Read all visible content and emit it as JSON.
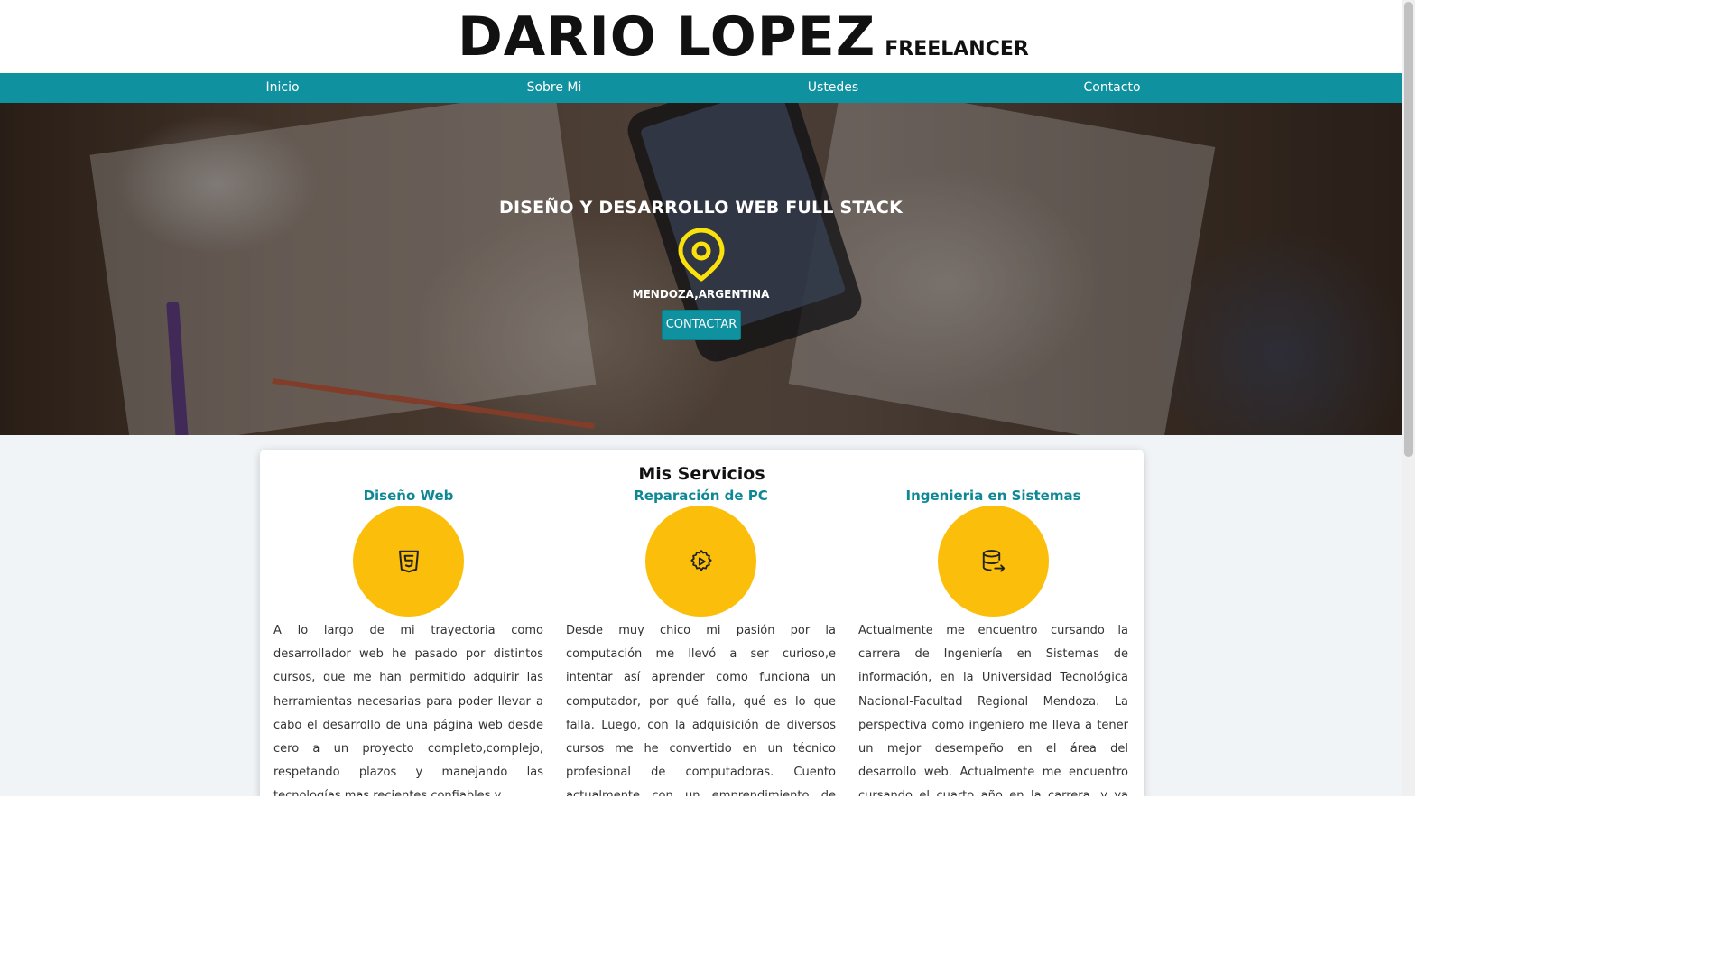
{
  "header": {
    "name": "DARIO LOPEZ",
    "role": "FREELANCER"
  },
  "nav": [
    {
      "label": "Inicio"
    },
    {
      "label": "Sobre Mi"
    },
    {
      "label": "Ustedes"
    },
    {
      "label": "Contacto"
    }
  ],
  "hero": {
    "title": "DISEÑO Y DESARROLLO WEB FULL STACK",
    "location_icon": "map-pin-icon",
    "location": "MENDOZA,ARGENTINA",
    "cta_label": "CONTACTAR"
  },
  "services": {
    "title": "Mis Servicios",
    "items": [
      {
        "title": "Diseño Web",
        "icon": "html5-icon",
        "text": "A lo largo de mi trayectoria como desarrollador web he pasado por distintos cursos, que me han permitido adquirir las herramientas necesarias para poder llevar a cabo el desarrollo de una página web desde cero a un proyecto completo,complejo, respetando plazos y manejando las tecnologías mas recientes,confiables y"
      },
      {
        "title": "Reparación de PC",
        "icon": "gear-play-icon",
        "text": "Desde muy chico mi pasión por la computación me llevó a ser curioso,e intentar así aprender como funciona un computador, por qué falla, qué es lo que falla. Luego, con la adquisición de diversos cursos me he convertido en un técnico profesional de computadoras. Cuento actualmente con un emprendimiento de servicio técnico"
      },
      {
        "title": "Ingenieria en Sistemas",
        "icon": "database-export-icon",
        "text": "Actualmente me encuentro cursando la carrera de Ingeniería en Sistemas de información, en la Universidad Tecnológica Nacional-Facultad Regional Mendoza. La perspectiva como ingeniero me lleva a tener un mejor desempeño en el área del desarrollo web. Actualmente me encuentro cursando el cuarto año en la carrera, y ya tengo un buen"
      }
    ]
  },
  "colors": {
    "accent": "#0f919f",
    "service_title": "#0f8895",
    "circle": "#fbbf0b",
    "pin": "#fbe10b"
  }
}
